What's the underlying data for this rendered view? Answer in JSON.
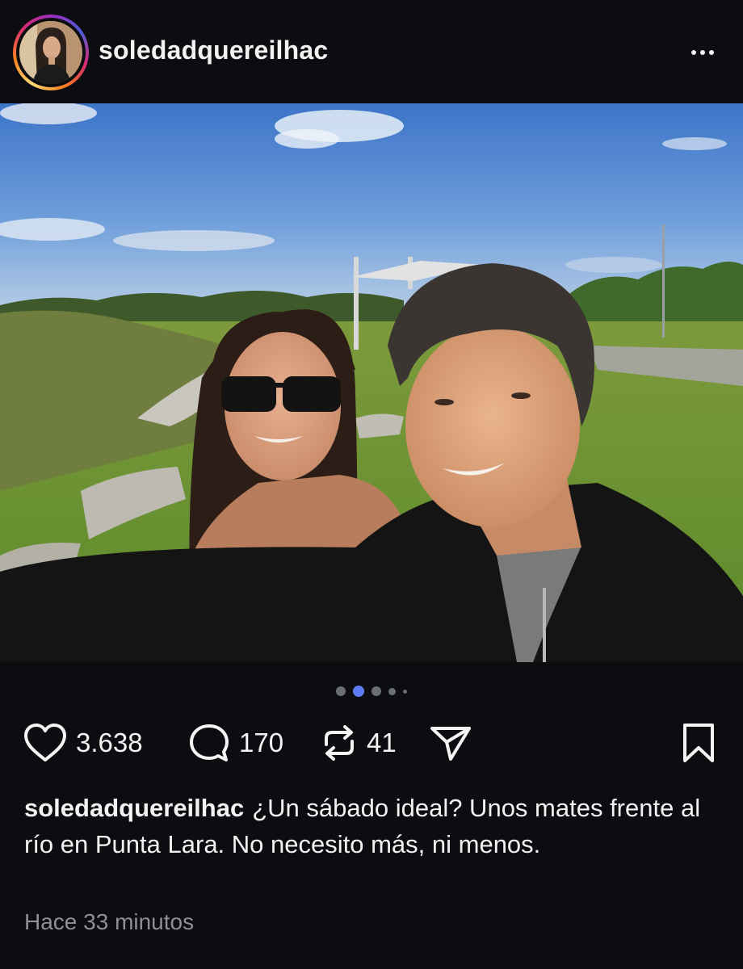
{
  "post": {
    "username": "soledadquereilhac",
    "more_icon": "more-horizontal-icon",
    "carousel": {
      "count": 5,
      "active_index": 1
    },
    "actions": {
      "likes": "3.638",
      "comments": "170",
      "reposts": "41",
      "like_icon": "heart-icon",
      "comment_icon": "comment-bubble-icon",
      "repost_icon": "repost-arrows-icon",
      "share_icon": "paper-plane-icon",
      "save_icon": "bookmark-icon"
    },
    "caption": {
      "username": "soledadquereilhac",
      "text": "¿Un sábado ideal? Unos mates frente al río en Punta Lara. No necesito más, ni menos."
    },
    "timestamp": "Hace 33 minutos"
  },
  "colors": {
    "background": "#0b0d11",
    "text": "#f2f2f2",
    "muted_text": "#8e9096",
    "active_dot": "#5b7cf5",
    "inactive_dot": "#6b6e75"
  }
}
